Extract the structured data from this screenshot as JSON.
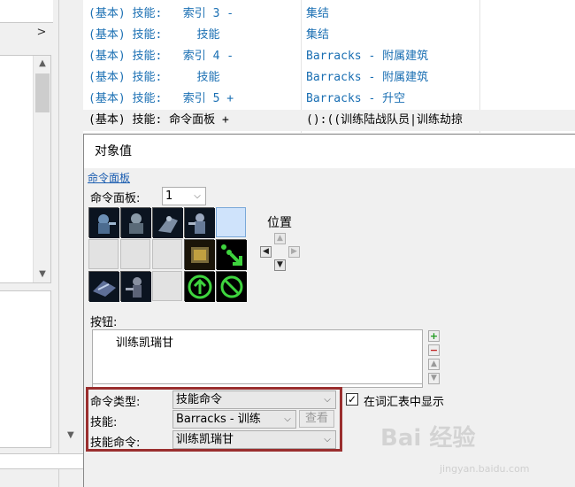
{
  "trigger_list": {
    "rows": [
      {
        "col1": "(基本) 技能:   索引 3 -",
        "col2": "集结"
      },
      {
        "col1": "(基本) 技能:     技能",
        "col2": "集结"
      },
      {
        "col1": "(基本) 技能:   索引 4 -",
        "col2": "Barracks - 附属建筑"
      },
      {
        "col1": "(基本) 技能:     技能",
        "col2": "Barracks - 附属建筑"
      },
      {
        "col1": "(基本) 技能:   索引 5 +",
        "col2": "Barracks - 升空"
      },
      {
        "col1": "(基本) 技能: 命令面板 +",
        "col2": "():((训练陆战队员|训练劫掠"
      }
    ]
  },
  "dialog": {
    "title": "对象值",
    "link_label": "命令面板",
    "panel_label": "命令面板:",
    "panel_value": "1",
    "position_label": "位置",
    "buttons_label": "按钮:",
    "buttons_list": [
      "训练凯瑞甘"
    ],
    "command_type_label": "命令类型:",
    "command_type_value": "技能命令",
    "show_in_vocab_label": "在词汇表中显示",
    "show_in_vocab_checked": true,
    "skill_label": "技能:",
    "skill_value": "Barracks - 训练",
    "view_button": "查看",
    "skill_command_label": "技能命令:",
    "skill_command_value": "训练凯瑞甘"
  },
  "watermark": {
    "main": "Bai 经验",
    "sub": "jingyan.baidu.com"
  },
  "colors": {
    "link": "#1a6fb3",
    "highlight_frame": "#9a2e2e",
    "selected_cell": "#cfe3fb"
  },
  "icons": [
    "chevron-right-icon",
    "scroll-up-icon",
    "scroll-down-icon",
    "plus-icon",
    "minus-icon",
    "arrow-up-icon",
    "arrow-down-icon",
    "checkmark-icon"
  ]
}
